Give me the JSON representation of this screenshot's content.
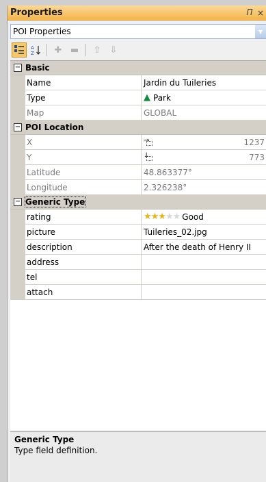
{
  "panel": {
    "title": "Properties",
    "pin_icon": "pin-icon",
    "close_icon": "close-icon"
  },
  "selector": {
    "value": "POI Properties"
  },
  "toolbar": {
    "categorized": "categorized-icon",
    "alphabetical": "sort-az-icon",
    "add": "plus-icon",
    "remove": "minus-icon",
    "up": "arrow-up-icon",
    "down": "arrow-down-icon"
  },
  "categories": {
    "basic": {
      "label": "Basic",
      "rows": {
        "name": {
          "label": "Name",
          "value": "Jardin du Tuileries"
        },
        "type": {
          "label": "Type",
          "value": "Park",
          "icon": "tree-icon"
        },
        "map": {
          "label": "Map",
          "value": "GLOBAL"
        }
      }
    },
    "location": {
      "label": "POI Location",
      "rows": {
        "x": {
          "label": "X",
          "value": "1237"
        },
        "y": {
          "label": "Y",
          "value": "773"
        },
        "latitude": {
          "label": "Latitude",
          "value": "48.863377°"
        },
        "longitude": {
          "label": "Longitude",
          "value": "2.326238°"
        }
      }
    },
    "generic": {
      "label": "Generic Type",
      "rows": {
        "rating": {
          "label": "rating",
          "value": "Good",
          "stars_filled": 3,
          "stars_total": 5
        },
        "picture": {
          "label": "picture",
          "value": "Tuileries_02.jpg"
        },
        "description": {
          "label": "description",
          "value": "After the death of Henry II"
        },
        "address": {
          "label": "address",
          "value": ""
        },
        "tel": {
          "label": "tel",
          "value": ""
        },
        "attach": {
          "label": "attach",
          "value": ""
        }
      }
    }
  },
  "description_panel": {
    "title": "Generic Type",
    "text": "Type field definition."
  },
  "colors": {
    "title_bar": "#f4b54c",
    "category_bg": "#d4d0c8",
    "readonly_text": "#7a7a7a",
    "tree": "#128c3c",
    "star": "#e8b21a"
  }
}
